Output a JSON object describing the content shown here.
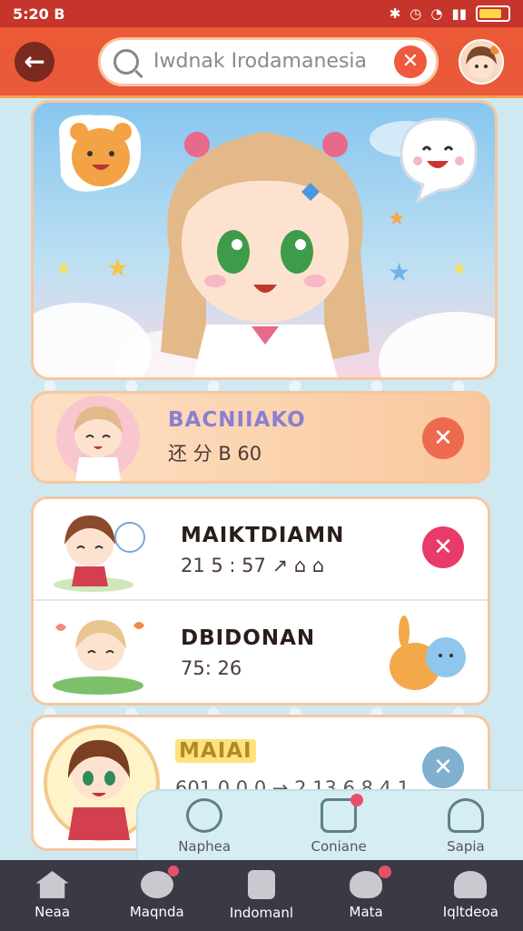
{
  "status_bar": {
    "time": "5:20 B"
  },
  "header": {
    "search_value": "Iwdnak Irodamanesia",
    "back_icon": "arrow-left-icon",
    "clear_icon": "close-icon"
  },
  "list": [
    {
      "title": "BACNIIAKO",
      "meta": "还 分 B 60",
      "action_color": "#ee6a4f"
    },
    {
      "title": "MAIKTDIAMN",
      "meta": "21 5 : 57 ↗ ⌂ ⌂",
      "action_color": "#e83b6a"
    },
    {
      "title": "DBIDONAN",
      "meta": "75: 26",
      "action_color": ""
    },
    {
      "title": "MAIAI",
      "meta": "601 0 0 0 → 2 13 6 8 4 1",
      "action_color": "#7fb0cf"
    }
  ],
  "sub_tabs": [
    {
      "label": "Naphea",
      "icon": "search-person-icon"
    },
    {
      "label": "Coniane",
      "icon": "notification-icon"
    },
    {
      "label": "Sapia",
      "icon": "person-icon"
    }
  ],
  "bottom_nav": [
    {
      "label": "Neaa",
      "icon": "home-icon"
    },
    {
      "label": "Maqnda",
      "icon": "chat-icon"
    },
    {
      "label": "Indomanl",
      "icon": "document-icon"
    },
    {
      "label": "Mata",
      "icon": "bird-icon"
    },
    {
      "label": "Iqltdeoa",
      "icon": "profile-icon"
    }
  ]
}
